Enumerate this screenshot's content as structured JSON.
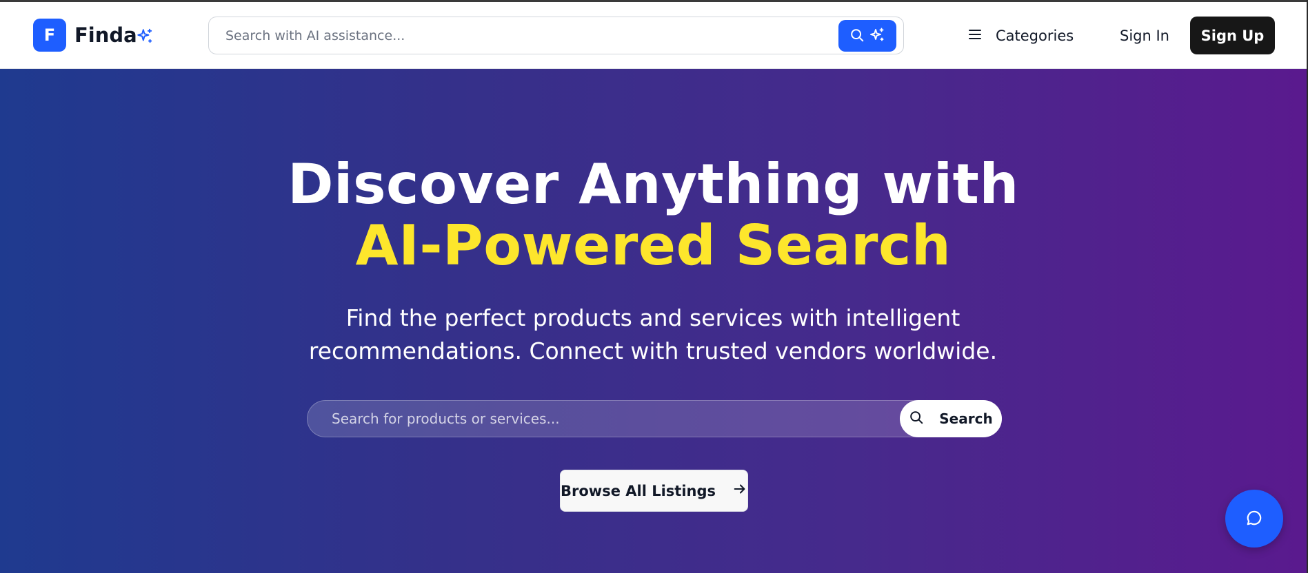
{
  "header": {
    "logo_letter": "F",
    "brand_name": "Finda",
    "search_placeholder": "Search with AI assistance...",
    "categories_label": "Categories",
    "sign_in_label": "Sign In",
    "sign_up_label": "Sign Up"
  },
  "hero": {
    "title_line1": "Discover Anything with",
    "title_line2": "AI-Powered Search",
    "subtitle": "Find the perfect products and services with intelligent recommendations. Connect with trusted vendors worldwide.",
    "search_placeholder": "Search for products or services...",
    "search_button_label": "Search",
    "browse_label": "Browse All Listings"
  },
  "icons": {
    "brand_spark": "sparkles-icon",
    "header_search": "search-icon",
    "header_ai": "sparkles-icon",
    "menu": "hamburger-menu-icon",
    "hero_search": "search-icon",
    "browse_arrow": "arrow-right-icon",
    "chat": "chat-bubble-icon"
  },
  "colors": {
    "brand_blue": "#1e5eff",
    "accent_yellow": "#fde62c",
    "hero_gradient_start": "#1f3a8f",
    "hero_gradient_end": "#5a1a8e",
    "signup_bg": "#171717"
  }
}
